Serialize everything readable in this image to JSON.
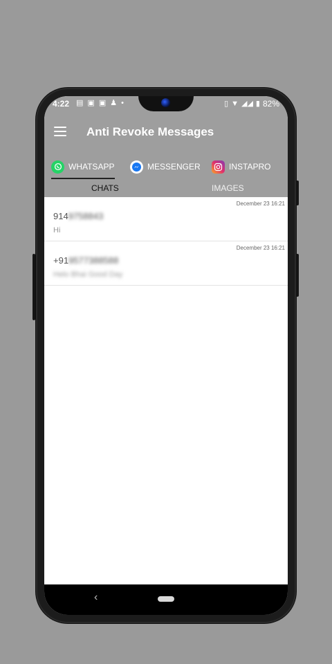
{
  "status": {
    "time": "4:22",
    "battery": "82%"
  },
  "toolbar": {
    "title": "Anti Revoke Messages"
  },
  "app_tabs": [
    {
      "label": "WHATSAPP",
      "icon": "whatsapp-icon",
      "color": "#25D366",
      "selected": true
    },
    {
      "label": "MESSENGER",
      "icon": "messenger-icon",
      "color": "#1877F2",
      "selected": false
    },
    {
      "label": "INSTAPRO",
      "icon": "instagram-icon",
      "color": "#C13584",
      "selected": false
    }
  ],
  "sub_tabs": [
    {
      "label": "CHATS",
      "selected": true
    },
    {
      "label": "IMAGES",
      "selected": false
    }
  ],
  "chats": [
    {
      "date": "December 23 16:21",
      "name_visible": "914",
      "name_blurred": "9758843",
      "message_visible": "Hi",
      "message_blurred": ""
    },
    {
      "date": "December 23 16:21",
      "name_visible": "+91",
      "name_blurred": "9577388588",
      "message_visible": "",
      "message_blurred": "Helo Bhai Good Day"
    }
  ],
  "colors": {
    "header": "#9e9e9e",
    "accent_underline": "#222222"
  }
}
